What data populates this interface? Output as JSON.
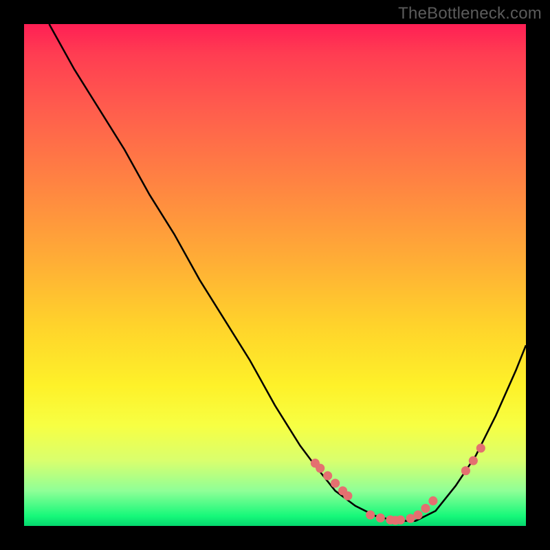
{
  "watermark": "TheBottleneck.com",
  "chart_data": {
    "type": "line",
    "title": "",
    "xlabel": "",
    "ylabel": "",
    "xlim": [
      0,
      100
    ],
    "ylim": [
      0,
      100
    ],
    "series": [
      {
        "name": "curve",
        "x": [
          5,
          10,
          15,
          20,
          25,
          30,
          35,
          40,
          45,
          50,
          55,
          58,
          62,
          66,
          70,
          74,
          78,
          82,
          86,
          90,
          94,
          98,
          100
        ],
        "values": [
          100,
          91,
          83,
          75,
          66,
          58,
          49,
          41,
          33,
          24,
          16,
          12,
          7,
          4,
          2,
          1,
          1,
          3,
          8,
          14,
          22,
          31,
          36
        ]
      }
    ],
    "markers": [
      {
        "name": "cluster-left",
        "x": [
          58,
          59,
          60.5,
          62,
          63.5,
          64.5
        ],
        "y": [
          12.5,
          11.5,
          10,
          8.5,
          7,
          6
        ]
      },
      {
        "name": "cluster-bottom",
        "x": [
          69,
          71,
          73,
          74,
          75,
          77,
          78.5,
          80,
          81.5
        ],
        "y": [
          2.2,
          1.6,
          1.2,
          1.1,
          1.2,
          1.5,
          2.2,
          3.5,
          5
        ]
      },
      {
        "name": "cluster-right",
        "x": [
          88,
          89.5,
          91
        ],
        "y": [
          11,
          13,
          15.5
        ]
      }
    ],
    "colors": {
      "curve": "#000000",
      "marker": "#e47070"
    }
  }
}
